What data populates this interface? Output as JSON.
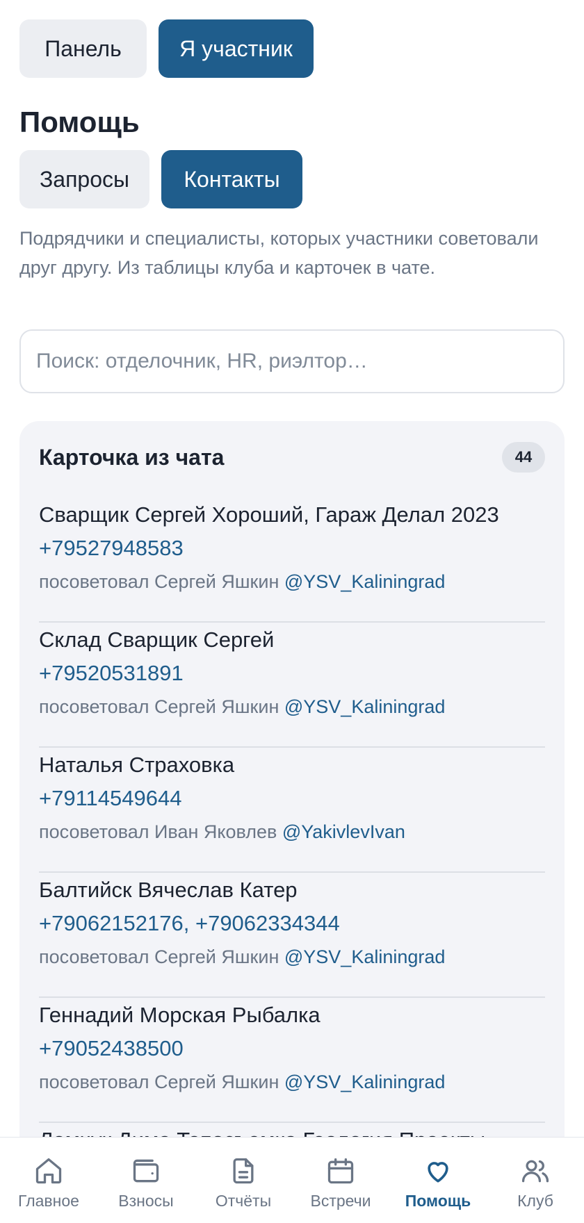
{
  "view_switch": [
    {
      "label": "Панель",
      "active": false
    },
    {
      "label": "Я участник",
      "active": true
    }
  ],
  "section": {
    "title": "Помощь"
  },
  "help_tabs": [
    {
      "label": "Запросы",
      "active": false
    },
    {
      "label": "Контакты",
      "active": true
    }
  ],
  "description": "Подрядчики и специалисты, которых участники советовали друг другу. Из таблицы клуба и карточек в чате.",
  "search": {
    "placeholder": "Поиск: отделочник, HR, риэлтор…",
    "value": ""
  },
  "card": {
    "title": "Карточка из чата",
    "count": "44",
    "contacts": [
      {
        "name": "Сварщик Сергей Хороший, Гараж Делал 2023",
        "phone": "+79527948583",
        "recommended_by": "посоветовал Сергей Яшкин",
        "handle": "@YSV_Kaliningrad"
      },
      {
        "name": "Склад Сварщик Сергей",
        "phone": "+79520531891",
        "recommended_by": "посоветовал Сергей Яшкин",
        "handle": "@YSV_Kaliningrad"
      },
      {
        "name": "Наталья Страховка",
        "phone": "+79114549644",
        "recommended_by": "посоветовал Иван Яковлев",
        "handle": "@YakivlevIvan"
      },
      {
        "name": "Балтийск Вячеслав Катер",
        "phone": "+79062152176, +79062334344",
        "recommended_by": "посоветовал Сергей Яшкин",
        "handle": "@YSV_Kaliningrad"
      },
      {
        "name": "Геннадий Морская Рыбалка",
        "phone": "+79052438500",
        "recommended_by": "посоветовал Сергей Яшкин",
        "handle": "@YSV_Kaliningrad"
      },
      {
        "name": "Ломчук Дима Топосъемка Геология Проекты",
        "phone": "",
        "recommended_by": "",
        "handle": ""
      }
    ]
  },
  "nav": {
    "items": [
      {
        "label": "Главное",
        "icon": "home-icon",
        "active": false
      },
      {
        "label": "Взносы",
        "icon": "wallet-icon",
        "active": false
      },
      {
        "label": "Отчёты",
        "icon": "document-icon",
        "active": false
      },
      {
        "label": "Встречи",
        "icon": "calendar-icon",
        "active": false
      },
      {
        "label": "Помощь",
        "icon": "heart-icon",
        "active": true
      },
      {
        "label": "Клуб",
        "icon": "users-icon",
        "active": false
      }
    ]
  },
  "colors": {
    "accent": "#1f5d8c",
    "muted_text": "#6a7585",
    "card_bg": "#f3f4f8"
  }
}
